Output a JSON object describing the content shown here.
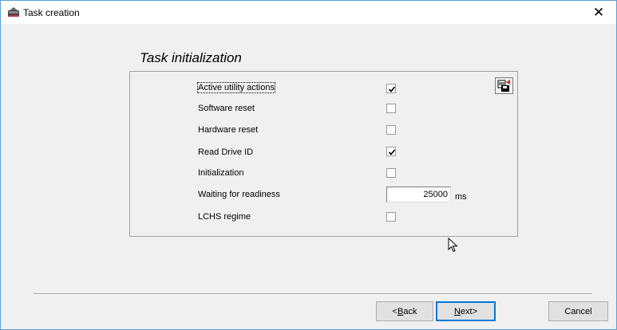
{
  "window": {
    "title": "Task creation",
    "close_glyph": "✕"
  },
  "section": {
    "title": "Task initialization"
  },
  "rows": [
    {
      "label": "Active utility actions",
      "checked": true
    },
    {
      "label": "Software reset",
      "checked": false
    },
    {
      "label": "Hardware reset",
      "checked": false
    },
    {
      "label": "Read Drive ID",
      "checked": true
    },
    {
      "label": "Initialization",
      "checked": false
    },
    {
      "label": "Waiting for readiness",
      "value": "25000",
      "unit": "ms"
    },
    {
      "label": "LCHS regime",
      "checked": false
    }
  ],
  "buttons": {
    "back": {
      "accel": "B",
      "rest": "ack",
      "prefix": "<"
    },
    "next": {
      "accel": "N",
      "rest": "ext>"
    },
    "cancel": "Cancel"
  },
  "icons": {
    "app": "hdd-utility-icon",
    "save": "save-settings-icon"
  }
}
